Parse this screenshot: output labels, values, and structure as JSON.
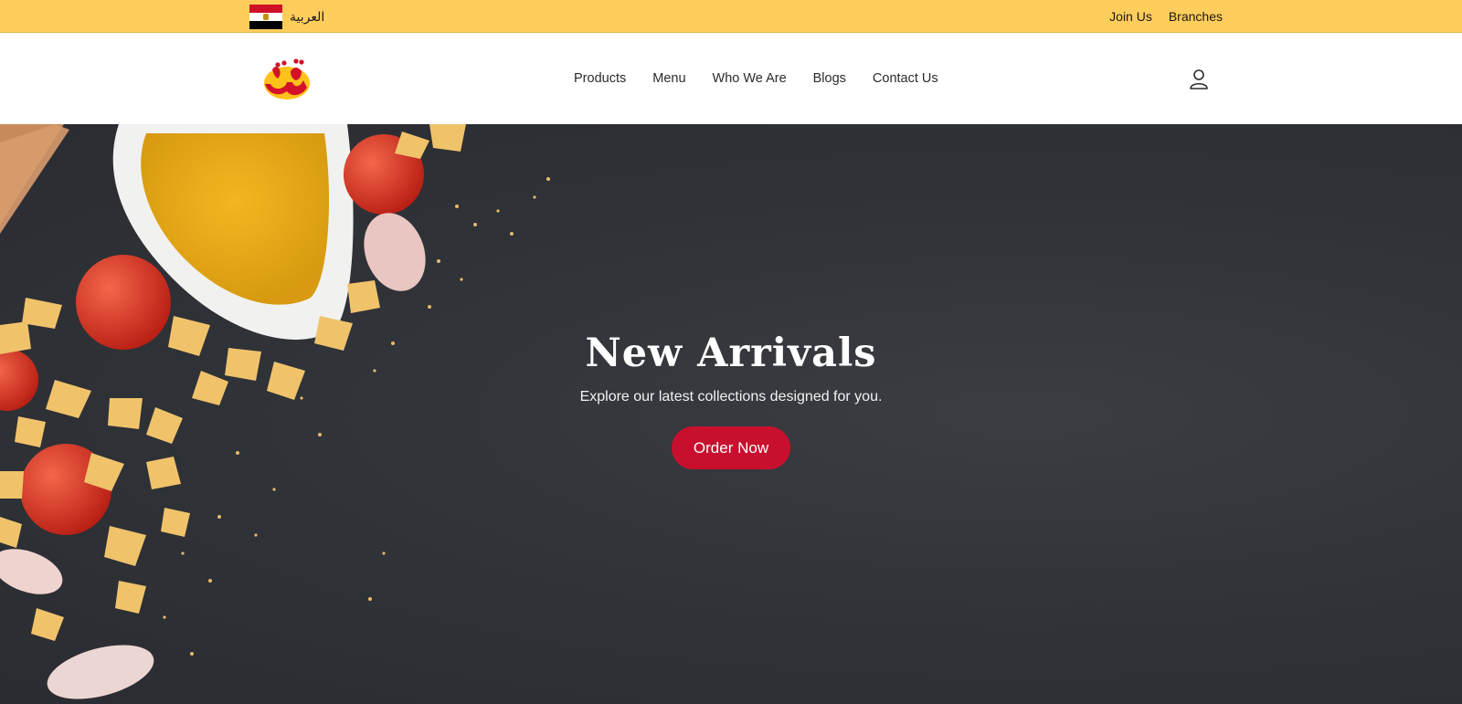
{
  "topbar": {
    "language_label": "العربية",
    "links": [
      "Join Us",
      "Branches"
    ],
    "background_color": "#ffcd5c"
  },
  "header": {
    "logo_alt": "شرق",
    "nav": [
      "Products",
      "Menu",
      "Who We Are",
      "Blogs",
      "Contact Us"
    ],
    "account_icon": "user-icon"
  },
  "hero": {
    "title": "New Arrivals",
    "subtitle": "Explore our latest collections designed for you.",
    "cta_label": "Order Now",
    "cta_color": "#c8102e",
    "background_color": "#2f3237"
  }
}
